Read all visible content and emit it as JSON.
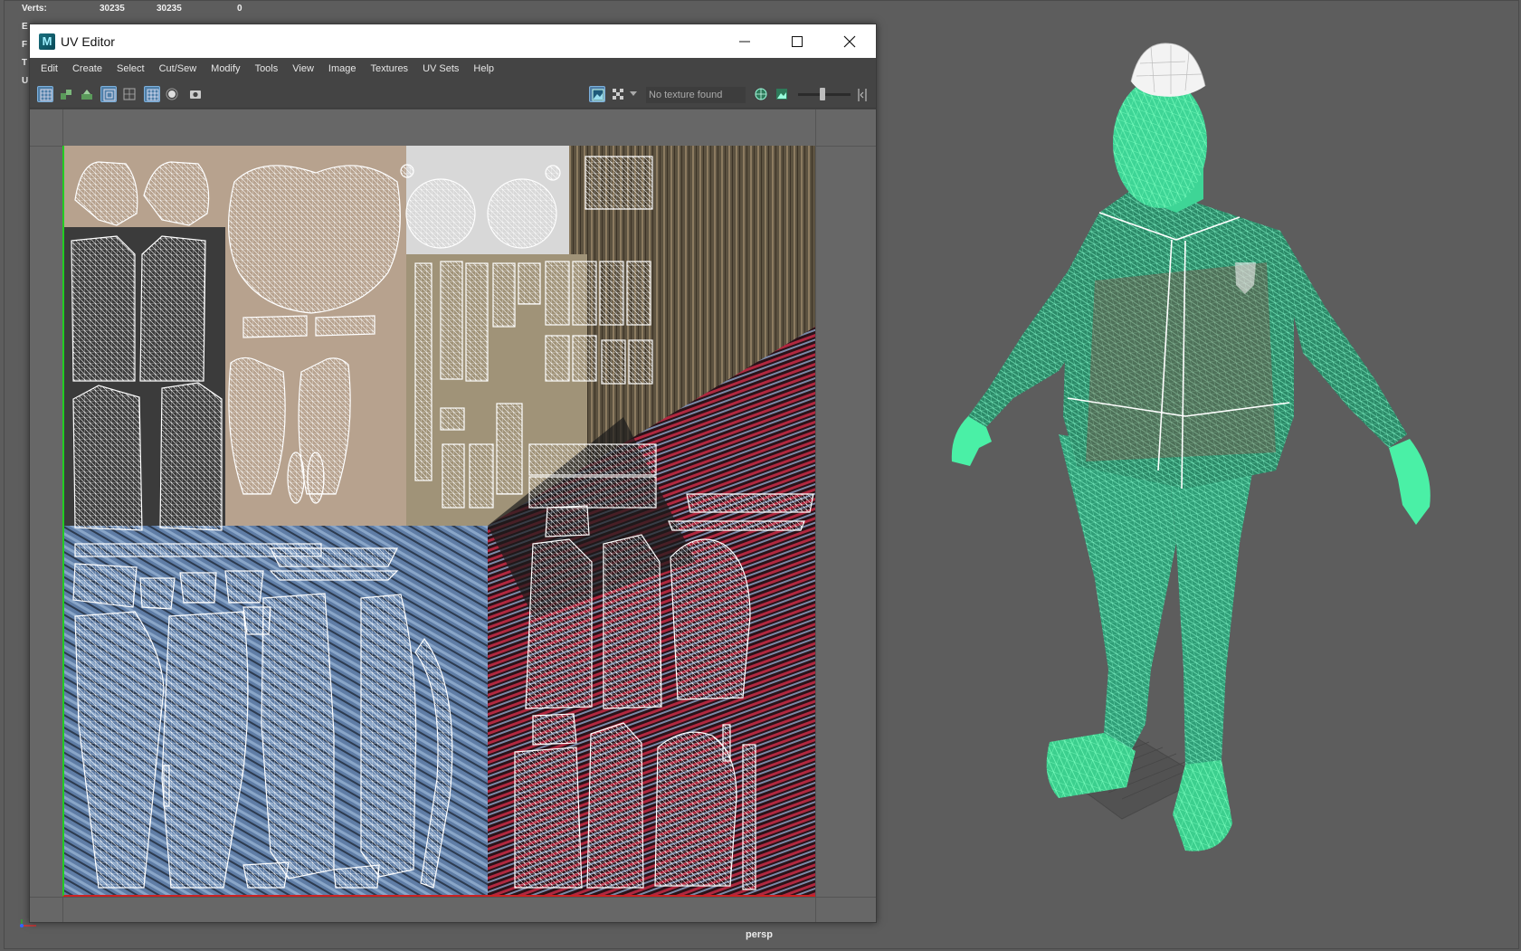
{
  "hud": {
    "rows": [
      {
        "label": "Verts:",
        "v1": "30235",
        "v2": "30235",
        "v3": "0"
      },
      {
        "label": "E",
        "v1": "",
        "v2": "",
        "v3": ""
      },
      {
        "label": "F",
        "v1": "",
        "v2": "",
        "v3": ""
      },
      {
        "label": "T",
        "v1": "",
        "v2": "",
        "v3": ""
      },
      {
        "label": "U",
        "v1": "",
        "v2": "",
        "v3": ""
      }
    ]
  },
  "uv_editor": {
    "title": "UV Editor",
    "app_icon": "maya-icon",
    "menu": [
      "Edit",
      "Create",
      "Select",
      "Cut/Sew",
      "Modify",
      "Tools",
      "View",
      "Image",
      "Textures",
      "UV Sets",
      "Help"
    ],
    "texture_status": "No texture found",
    "exposure_slider_value": 0.45
  },
  "viewport": {
    "camera_label": "persp"
  },
  "colors": {
    "wireframe_selected": "#5cf0a8",
    "uv_wire": "#ffffff",
    "background": "#5d5d5d",
    "accent": "#4f7fa8"
  }
}
